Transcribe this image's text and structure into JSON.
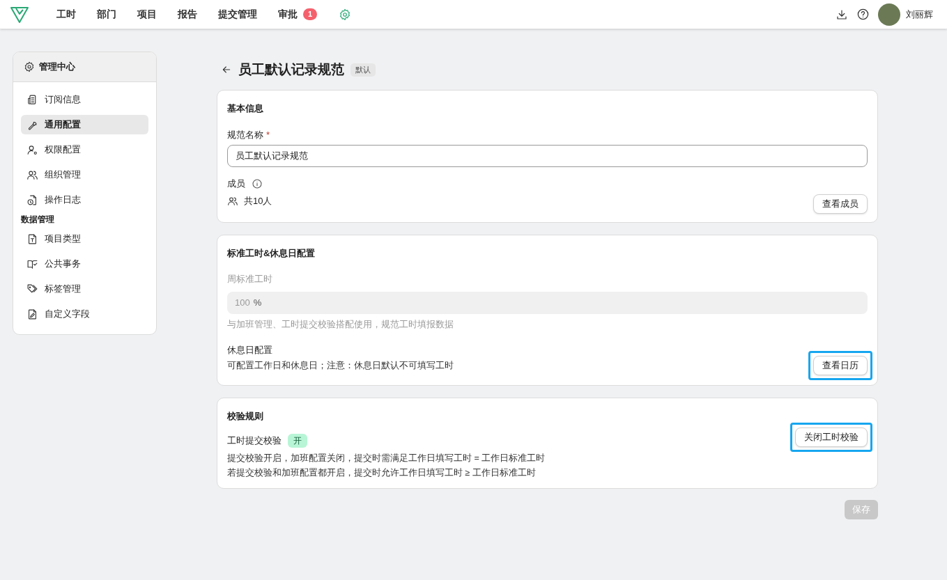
{
  "nav": {
    "items": [
      {
        "label": "工时",
        "selected": false
      },
      {
        "label": "部门",
        "selected": false
      },
      {
        "label": "项目",
        "selected": false
      },
      {
        "label": "报告",
        "selected": false
      },
      {
        "label": "提交管理",
        "selected": false
      },
      {
        "label": "审批",
        "selected": false,
        "badge": "1"
      }
    ],
    "settings_selected": true,
    "user": "刘丽辉"
  },
  "sidebar": {
    "title": "管理中心",
    "sections": [
      {
        "items": [
          {
            "label": "订阅信息",
            "selected": false
          },
          {
            "label": "通用配置",
            "selected": true
          },
          {
            "label": "权限配置",
            "selected": false
          },
          {
            "label": "组织管理",
            "selected": false
          },
          {
            "label": "操作日志",
            "selected": false
          }
        ]
      },
      {
        "heading": "数据管理",
        "items": [
          {
            "label": "项目类型",
            "selected": false
          },
          {
            "label": "公共事务",
            "selected": false
          },
          {
            "label": "标签管理",
            "selected": false
          },
          {
            "label": "自定义字段",
            "selected": false
          }
        ]
      }
    ]
  },
  "page": {
    "title": "员工默认记录规范",
    "tag": "默认"
  },
  "basic": {
    "title": "基本信息",
    "name_label": "规范名称",
    "required_mark": "*",
    "name_value": "员工默认记录规范",
    "members_label": "成员",
    "members_count": "共10人",
    "members_button": {
      "label": "查看成员",
      "highlighted": false
    }
  },
  "standard": {
    "title": "标准工时&休息日配置",
    "weekly_label": "周标准工时",
    "weekly_value": "100",
    "weekly_unit": "%",
    "weekly_disabled": true,
    "weekly_hint": "与加班管理、工时提交校验搭配使用，规范工时填报数据",
    "rest_title": "休息日配置",
    "rest_desc": "可配置工作日和休息日；注意：休息日默认不可填写工时",
    "calendar_button": {
      "label": "查看日历",
      "highlighted": true
    }
  },
  "rules": {
    "title": "校验规则",
    "check_label": "工时提交校验",
    "check_on": true,
    "check_badge": "开",
    "lines": [
      "提交校验开启，加班配置关闭，提交时需满足工作日填写工时 = 工作日标准工时",
      "若提交校验和加班配置都开启，提交时允许工作日填写工时 ≥ 工作日标准工时"
    ],
    "toggle_button": {
      "label": "关闭工时校验",
      "highlighted": true
    }
  },
  "save_button": {
    "label": "保存",
    "disabled": true
  }
}
